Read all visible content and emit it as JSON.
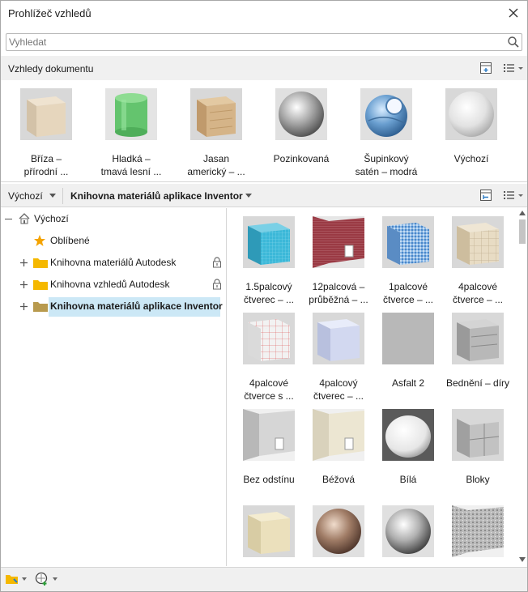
{
  "window": {
    "title": "Prohlížeč vzhledů"
  },
  "search": {
    "placeholder": "Vyhledat"
  },
  "doc": {
    "header": "Vzhledy dokumentu",
    "items": [
      {
        "line1": "Bříza –",
        "line2": "přírodní ...",
        "icon": "birch-cube-thumbnail"
      },
      {
        "line1": "Hladká –",
        "line2": "tmavá lesní ...",
        "icon": "green-cylinder-thumbnail"
      },
      {
        "line1": "Jasan",
        "line2": "americký – ...",
        "icon": "ash-cube-thumbnail"
      },
      {
        "line1": "Pozinkovaná",
        "line2": "",
        "icon": "galvanized-sphere-thumbnail"
      },
      {
        "line1": "Šupinkový",
        "line2": "satén – modrá",
        "icon": "blue-satin-sphere-thumbnail"
      },
      {
        "line1": "Výchozí",
        "line2": "",
        "icon": "default-sphere-thumbnail"
      }
    ]
  },
  "library": {
    "dropdown1": "Výchozí",
    "dropdown2": "Knihovna materiálů aplikace Inventor"
  },
  "tree": {
    "root": "Výchozí",
    "favorites": "Oblíbené",
    "items": [
      {
        "label": "Knihovna materiálů Autodesk",
        "locked": true
      },
      {
        "label": "Knihovna vzhledů Autodesk",
        "locked": true
      },
      {
        "label": "Knihovna materiálů aplikace Inventor",
        "locked": false,
        "selected": true
      }
    ]
  },
  "grid": {
    "items": [
      {
        "line1": "1.5palcový",
        "line2": "čtverec – ...",
        "icon": "cyan-tile-cube"
      },
      {
        "line1": "12palcová –",
        "line2": "průběžná – ...",
        "icon": "red-tile-wall"
      },
      {
        "line1": "1palcové",
        "line2": "čtverce – ...",
        "icon": "blue-mosaic-cube"
      },
      {
        "line1": "4palcové",
        "line2": "čtverce – ...",
        "icon": "beige-tile-cube"
      },
      {
        "line1": "4palcové",
        "line2": "čtverce s ...",
        "icon": "white-grid-cube"
      },
      {
        "line1": "4palcový",
        "line2": "čtverec – ...",
        "icon": "lavender-tile-cube"
      },
      {
        "line1": "Asfalt 2",
        "line2": "",
        "icon": "asphalt-swatch"
      },
      {
        "line1": "Bednění – díry",
        "line2": "",
        "icon": "formwork-cube"
      },
      {
        "line1": "Bez odstínu",
        "line2": "",
        "icon": "gray-wall-chair"
      },
      {
        "line1": "Béžová",
        "line2": "",
        "icon": "beige-wall-chair"
      },
      {
        "line1": "Bílá",
        "line2": "",
        "icon": "white-sphere"
      },
      {
        "line1": "Bloky",
        "line2": "",
        "icon": "blocks-cube"
      },
      {
        "line1": "",
        "line2": "",
        "icon": "cream-cube"
      },
      {
        "line1": "",
        "line2": "",
        "icon": "bronze-sphere"
      },
      {
        "line1": "",
        "line2": "",
        "icon": "chrome-sphere"
      },
      {
        "line1": "",
        "line2": "",
        "icon": "granite-wall"
      }
    ]
  },
  "colors": {
    "selection": "#cce8f6",
    "folder": "#f5b800",
    "folder_open": "#b89a4e",
    "star": "#f4a300"
  }
}
